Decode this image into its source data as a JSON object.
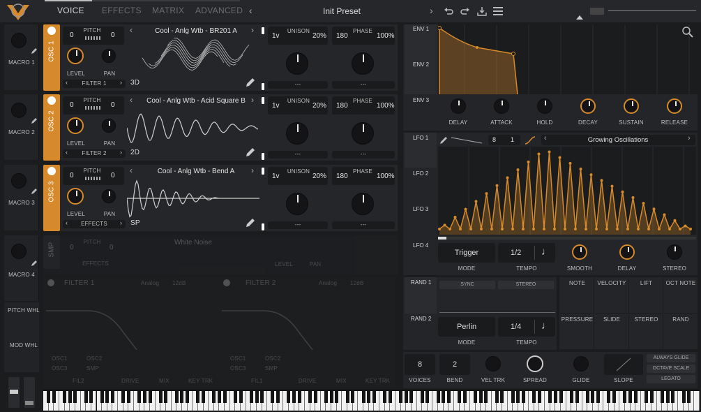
{
  "header": {
    "tabs": [
      {
        "label": "VOICE"
      },
      {
        "label": "EFFECTS"
      },
      {
        "label": "MATRIX"
      },
      {
        "label": "ADVANCED"
      }
    ],
    "preset_name": "Init Preset"
  },
  "macros": [
    {
      "label": "MACRO 1"
    },
    {
      "label": "MACRO 2"
    },
    {
      "label": "MACRO 3"
    },
    {
      "label": "MACRO 4"
    }
  ],
  "wheels": {
    "pitch": "PITCH WHL",
    "mod": "MOD WHL"
  },
  "oscillators": [
    {
      "tab": "OSC 1",
      "pitch_left": "0",
      "pitch_label": "PITCH",
      "pitch_right": "0",
      "level": "LEVEL",
      "pan": "PAN",
      "footer": "FILTER 1",
      "wavetable": "Cool - Anlg Wtb - BR201 A",
      "view": "3D",
      "unison_voices": "1v",
      "unison_label": "UNISON",
      "unison_pct": "20%",
      "phase_val": "180",
      "phase_label": "PHASE",
      "phase_pct": "100%",
      "dash1": "---",
      "dash2": "---"
    },
    {
      "tab": "OSC 2",
      "pitch_left": "0",
      "pitch_label": "PITCH",
      "pitch_right": "0",
      "level": "LEVEL",
      "pan": "PAN",
      "footer": "FILTER 2",
      "wavetable": "Cool - Anlg Wtb - Acid Square B",
      "view": "2D",
      "unison_voices": "1v",
      "unison_label": "UNISON",
      "unison_pct": "20%",
      "phase_val": "180",
      "phase_label": "PHASE",
      "phase_pct": "100%",
      "dash1": "---",
      "dash2": "---"
    },
    {
      "tab": "OSC 3",
      "pitch_left": "0",
      "pitch_label": "PITCH",
      "pitch_right": "0",
      "level": "LEVEL",
      "pan": "PAN",
      "footer": "EFFECTS",
      "wavetable": "Cool - Anlg Wtb - Bend A",
      "view": "SP",
      "unison_voices": "1v",
      "unison_label": "UNISON",
      "unison_pct": "20%",
      "phase_val": "180",
      "phase_label": "PHASE",
      "phase_pct": "100%",
      "dash1": "---",
      "dash2": "---"
    }
  ],
  "sampler": {
    "tab": "SMP",
    "pitch_left": "0",
    "pitch_label": "PITCH",
    "pitch_right": "0",
    "footer": "EFFECTS",
    "sample": "White Noise",
    "level": "LEVEL",
    "pan": "PAN"
  },
  "filters": [
    {
      "title": "FILTER 1",
      "model": "Analog",
      "type": "12dB",
      "srcs": [
        "OSC1",
        "OSC2",
        "OSC3",
        "SMP"
      ],
      "fil": "FIL2",
      "drive": "DRIVE",
      "mix": "MIX",
      "keytrk": "KEY TRK"
    },
    {
      "title": "FILTER 2",
      "model": "Analog",
      "type": "12dB",
      "srcs": [
        "OSC1",
        "OSC2",
        "OSC3",
        "SMP"
      ],
      "fil": "FIL1",
      "drive": "DRIVE",
      "mix": "MIX",
      "keytrk": "KEY TRK"
    }
  ],
  "envelopes": {
    "tabs": [
      "ENV 1",
      "ENV 2",
      "ENV 3"
    ],
    "knobs": [
      "DELAY",
      "ATTACK",
      "HOLD",
      "DECAY",
      "SUSTAIN",
      "RELEASE"
    ]
  },
  "lfo": {
    "tabs": [
      "LFO 1",
      "LFO 2",
      "LFO 3",
      "LFO 4"
    ],
    "sync_num": "8",
    "sync_den": "1",
    "shape": "Growing Oscillations",
    "mode": "Trigger",
    "mode_label": "MODE",
    "tempo": "1/2",
    "tempo_label": "TEMPO",
    "knobs": [
      "SMOOTH",
      "DELAY",
      "STEREO"
    ]
  },
  "random": {
    "tabs": [
      "RAND 1",
      "RAND 2"
    ],
    "sync": "SYNC",
    "stereo": "STEREO",
    "mode": "Perlin",
    "mode_label": "MODE",
    "tempo": "1/4",
    "tempo_label": "TEMPO"
  },
  "mod_sources": [
    "NOTE",
    "VELOCITY",
    "LIFT",
    "OCT NOTE",
    "PRESSURE",
    "SLIDE",
    "STEREO",
    "RAND"
  ],
  "voice": {
    "voices": "8",
    "voices_label": "VOICES",
    "bend": "2",
    "bend_label": "BEND",
    "veltrk": "VEL TRK",
    "spread": "SPREAD",
    "glide": "GLIDE",
    "slope": "SLOPE",
    "always_glide": "ALWAYS GLIDE",
    "octave_scale": "OCTAVE SCALE",
    "legato": "LEGATO"
  },
  "colors": {
    "accent": "#d68a2c",
    "bg": "#1b1c1e",
    "panel": "#242528"
  }
}
